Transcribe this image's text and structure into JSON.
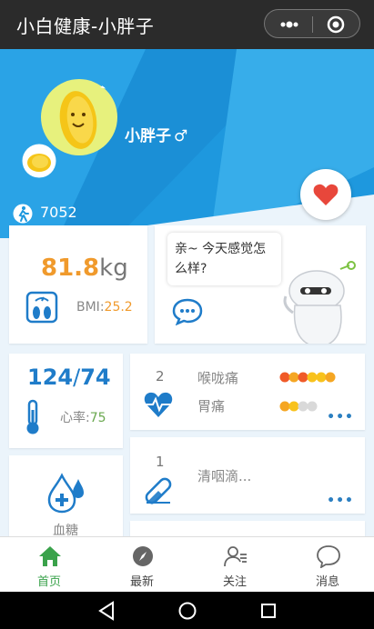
{
  "titlebar": {
    "title": "小白健康-小胖子"
  },
  "profile": {
    "name": "小胖子",
    "gender_symbol": "♂",
    "steps": "7052"
  },
  "weight": {
    "value": "81.8",
    "unit": "kg",
    "bmi_label": "BMI:",
    "bmi_value": "25.2"
  },
  "chat": {
    "greeting": "亲~ 今天感觉怎么样?"
  },
  "blood_pressure": {
    "systolic": "124",
    "slash": "/",
    "diastolic": "74",
    "hr_label": "心率:",
    "hr_value": "75"
  },
  "symptoms": {
    "count": "2",
    "items": [
      {
        "name": "喉咙痛",
        "dots": [
          "#f05a28",
          "#f5a623",
          "#f05a28",
          "#f8c21c",
          "#f8c21c",
          "#f5a623"
        ]
      },
      {
        "name": "胃痛",
        "dots": [
          "#f5a623",
          "#f8c21c",
          "#d9d9d9",
          "#d9d9d9"
        ]
      }
    ],
    "more": "•••"
  },
  "medication": {
    "count": "1",
    "text": "清咽滴...",
    "more": "•••"
  },
  "blood_sugar": {
    "label": "血糖"
  },
  "tabs": [
    {
      "label": "首页",
      "icon": "home-icon",
      "active": true
    },
    {
      "label": "最新",
      "icon": "compass-icon",
      "active": false
    },
    {
      "label": "关注",
      "icon": "follow-icon",
      "active": false
    },
    {
      "label": "消息",
      "icon": "message-icon",
      "active": false
    }
  ],
  "colors": {
    "brand_blue": "#1e98de",
    "accent_orange": "#f09a2c",
    "tab_active": "#3aa24b",
    "heart_red": "#e8473b"
  }
}
